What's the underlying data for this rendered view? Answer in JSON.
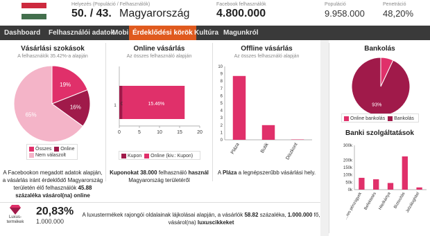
{
  "header": {
    "flag_colors": [
      "#cd2a3e",
      "#ffffff",
      "#436f4d"
    ],
    "position_label": "Helyezés (Populáció / Felhasználók)",
    "position_value": "50. / 43.",
    "country": "Magyarország",
    "facebook_label": "Facebook felhasználók",
    "facebook_value": "4.800.000",
    "population_label": "Populáció",
    "population_value": "9.958.000",
    "penetration_label": "Penetráció",
    "penetration_value": "48,20%"
  },
  "nav": {
    "items": [
      "Dashboard",
      "Felhasználói adatok",
      "Mobil",
      "Érdeklődési körök",
      "Kultúra",
      "Magunkról"
    ],
    "active_index": 3
  },
  "shopping_habits": {
    "title": "Vásárlási szokások",
    "subtitle": "A felhasználók 35.42%-a alapján",
    "legend": [
      "Összes",
      "Online",
      "Nem válaszolt"
    ],
    "caption_line1": "A Facebookon megadott adatok alapján,",
    "caption_line2": "a vásárlás iránt érdeklődő Magyarország",
    "caption_line3": "területén élő felhasználók",
    "caption_bold1": "45.88",
    "caption_line4": "százaléka vásárol(na) online"
  },
  "online_shopping": {
    "title": "Online vásárlás",
    "subtitle": "Az összes felhasználó alapján",
    "legend": [
      "Kupon",
      "Online (kiv.: Kupon)"
    ],
    "caption_bold": "Kuponokat 38.000",
    "caption_rest": "felhasználó",
    "caption_bold2": "használ",
    "caption_line2": "Magyarország területéről"
  },
  "offline_shopping": {
    "title": "Offline vásárlás",
    "subtitle": "Az összes felhasználó alapján",
    "caption_pre": "A",
    "caption_bold": "Pláza",
    "caption_rest": "a legnépszerűbb vásárlási hely."
  },
  "banking": {
    "title": "Bankolás",
    "legend": [
      "Online bankolás",
      "Bankolás"
    ]
  },
  "bank_services": {
    "title": "Banki szolgáltatások"
  },
  "luxury": {
    "icon_label": "Luxus-\ntermékek",
    "icon_label_1": "Luxus-",
    "icon_label_2": "termékek",
    "percent": "20,83%",
    "count": "1.000.000",
    "text_pre": "A luxustermékek rajongói oldalainak lájkolásai alapján, a vásárlók",
    "text_bold1": "58.82",
    "text_mid": "százaléka,",
    "text_bold2": "1.000.000",
    "text_mid2": "fő,",
    "text_line2": "vásárol(na)",
    "text_bold3": "luxuscikkeket"
  },
  "colors": {
    "dark": "#a01a4a",
    "pink": "#e0306a",
    "light": "#f4b4c8",
    "nav_bg": "#3a3a3a",
    "nav_active": "#e05a1e"
  },
  "chart_data": [
    {
      "type": "pie",
      "title": "Vásárlási szokások",
      "subtitle": "A felhasználók 35.42%-a alapján",
      "categories": [
        "Összes",
        "Online",
        "Nem válaszolt"
      ],
      "values": [
        19,
        16,
        65
      ],
      "labels": [
        "19%",
        "16%",
        "65%"
      ]
    },
    {
      "type": "bar",
      "orientation": "horizontal",
      "stacked": true,
      "title": "Online vásárlás",
      "subtitle": "Az összes felhasználó alapján",
      "categories": [
        "1"
      ],
      "series": [
        {
          "name": "Kupon",
          "values": [
            0.79
          ]
        },
        {
          "name": "Online (kiv.: Kupon)",
          "values": [
            15.46
          ]
        }
      ],
      "labels": [
        "0.79%",
        "15.46%"
      ],
      "xticks": [
        0,
        5,
        10,
        15,
        20
      ],
      "xlim": [
        0,
        20
      ]
    },
    {
      "type": "bar",
      "title": "Offline vásárlás",
      "subtitle": "Az összes felhasználó alapján",
      "categories": [
        "Pláza",
        "Butik",
        "Diszkont"
      ],
      "values": [
        8.7,
        2.0,
        0.05
      ],
      "yticks": [
        0,
        1,
        2,
        3,
        4,
        5,
        6,
        7,
        8,
        9,
        10
      ],
      "ylim": [
        0,
        10
      ]
    },
    {
      "type": "pie",
      "title": "Bankolás",
      "categories": [
        "Online bankolás",
        "Bankolás"
      ],
      "values": [
        7,
        93
      ],
      "labels": [
        "",
        "93%"
      ]
    },
    {
      "type": "bar",
      "title": "Banki szolgáltatások",
      "categories": [
        "...res pénzügyek",
        "Befektetés",
        "Hitelkártya",
        "Biztosítás",
        "Jelzáloghitel"
      ],
      "values": [
        80000,
        70000,
        45000,
        225000,
        15000
      ],
      "yticks": [
        "0k",
        "50k",
        "100k",
        "150k",
        "200k",
        "300k"
      ],
      "ylim": [
        0,
        300000
      ]
    }
  ]
}
